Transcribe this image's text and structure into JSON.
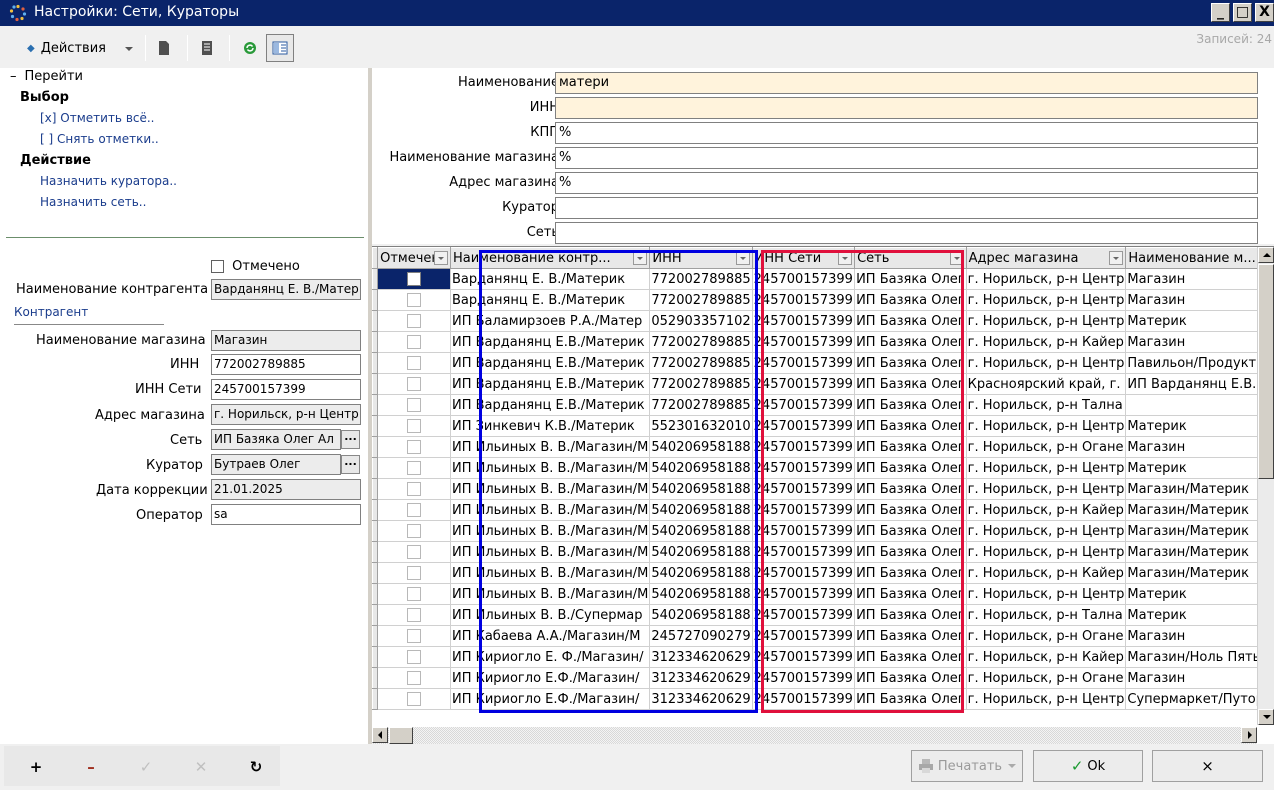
{
  "window": {
    "title": "Настройки: Сети, Кураторы",
    "min": "_",
    "max": "□",
    "close": "X"
  },
  "toolbar": {
    "actions_label": "Действия",
    "records_label": "Записей: 24"
  },
  "left_panel": {
    "goto": "Перейти",
    "select_header": "Выбор",
    "select_all": "[x]  Отметить всё..",
    "unselect": "[ ]  Снять отметки..",
    "action_header": "Действие",
    "assign_curator": "Назначить куратора..",
    "assign_network": "Назначить сеть.."
  },
  "detail": {
    "checked_label": "Отмечено",
    "counterparty_name_label": "Наименование контрагента",
    "counterparty_name": "Варданянц Е. В./Матер",
    "section_link": "Контрагент",
    "store_name_label": "Наименование магазина",
    "store_name": "Магазин",
    "inn_label": "ИНН",
    "inn": "772002789885",
    "network_inn_label": "ИНН Сети",
    "network_inn": "245700157399",
    "store_address_label": "Адрес магазина",
    "store_address": "г. Норильск, р-н Центр",
    "network_label": "Сеть",
    "network": "ИП Базяка Олег Ал",
    "curator_label": "Куратор",
    "curator": "Бутраев Олег",
    "date_label": "Дата коррекции",
    "date": "21.01.2025",
    "operator_label": "Оператор",
    "operator": "sa",
    "dots": "..."
  },
  "filters": [
    {
      "label": "Наименование",
      "value": "матери",
      "highlight": true
    },
    {
      "label": "ИНН",
      "value": "",
      "highlight": true
    },
    {
      "label": "КПП",
      "value": "%",
      "highlight": false
    },
    {
      "label": "Наименование магазина",
      "value": "%",
      "highlight": false
    },
    {
      "label": "Адрес магазина",
      "value": "%",
      "highlight": false
    },
    {
      "label": "Куратор",
      "value": "",
      "highlight": false
    },
    {
      "label": "Сеть",
      "value": "",
      "highlight": false
    }
  ],
  "grid": {
    "columns": [
      "Отмечено",
      "Наименование контр...",
      "ИНН",
      "ИНН Сети",
      "Сеть",
      "Адрес магазина",
      "Наименование м..."
    ],
    "rows": [
      [
        "Варданянц Е. В./Материк",
        "772002789885",
        "245700157399",
        "ИП Базяка Олег",
        "г. Норильск, р-н Центр",
        "Магазин"
      ],
      [
        "Варданянц Е. В./Материк",
        "772002789885",
        "245700157399",
        "ИП Базяка Олег",
        "г. Норильск, р-н Центр",
        "Магазин"
      ],
      [
        "ИП Баламирзоев Р.А./Матер",
        "052903357102",
        "245700157399",
        "ИП Базяка Олег",
        "г. Норильск, р-н Центр",
        "Материк"
      ],
      [
        "ИП Варданянц Е.В./Материк",
        "772002789885",
        "245700157399",
        "ИП Базяка Олег",
        "г. Норильск, р-н Кайер",
        "Магазин"
      ],
      [
        "ИП Варданянц Е.В./Материк",
        "772002789885",
        "245700157399",
        "ИП Базяка Олег",
        "г. Норильск, р-н Центр",
        "Павильон/Продукты"
      ],
      [
        "ИП Варданянц Е.В./Материк",
        "772002789885",
        "245700157399",
        "ИП Базяка Олег",
        "Красноярский край, г.",
        "ИП Варданянц Е.В."
      ],
      [
        "ИП Варданянц Е.В./Материк",
        "772002789885",
        "245700157399",
        "ИП Базяка Олег",
        "г. Норильск, р-н Тална",
        ""
      ],
      [
        "ИП Зинкевич К.В./Материк",
        "552301632010",
        "245700157399",
        "ИП Базяка Олег",
        "г. Норильск, р-н Центр",
        "Материк"
      ],
      [
        "ИП Ильиных В. В./Магазин/М",
        "540206958188",
        "245700157399",
        "ИП Базяка Олег",
        "г. Норильск, р-н Огане",
        "Магазин"
      ],
      [
        "ИП Ильиных В. В./Магазин/М",
        "540206958188",
        "245700157399",
        "ИП Базяка Олег",
        "г. Норильск, р-н Центр",
        "Материк"
      ],
      [
        "ИП Ильиных В. В./Магазин/М",
        "540206958188",
        "245700157399",
        "ИП Базяка Олег",
        "г. Норильск, р-н Центр",
        "Магазин/Материк"
      ],
      [
        "ИП Ильиных В. В./Магазин/М",
        "540206958188",
        "245700157399",
        "ИП Базяка Олег",
        "г. Норильск, р-н Кайер",
        "Магазин/Материк"
      ],
      [
        "ИП Ильиных В. В./Магазин/М",
        "540206958188",
        "245700157399",
        "ИП Базяка Олег",
        "г. Норильск, р-н Центр",
        "Магазин/Материк"
      ],
      [
        "ИП Ильиных В. В./Магазин/М",
        "540206958188",
        "245700157399",
        "ИП Базяка Олег",
        "г. Норильск, р-н Центр",
        "Магазин/Материк"
      ],
      [
        "ИП Ильиных В. В./Магазин/М",
        "540206958188",
        "245700157399",
        "ИП Базяка Олег",
        "г. Норильск, р-н Кайер",
        "Магазин/Материк"
      ],
      [
        "ИП Ильиных В. В./Магазин/М",
        "540206958188",
        "245700157399",
        "ИП Базяка Олег",
        "г. Норильск, р-н Центр",
        "Материк"
      ],
      [
        "ИП Ильиных В. В./Супермар",
        "540206958188",
        "245700157399",
        "ИП Базяка Олег",
        "г. Норильск, р-н Тална",
        "Материк"
      ],
      [
        "ИП Кабаева А.А./Магазин/М",
        "245727090279",
        "245700157399",
        "ИП Базяка Олег",
        "г. Норильск, р-н Огане",
        "Магазин"
      ],
      [
        "ИП Кириогло Е. Ф./Магазин/",
        "312334620629",
        "245700157399",
        "ИП Базяка Олег",
        "г. Норильск, р-н Кайер",
        "Магазин/Ноль Пять"
      ],
      [
        "ИП Кириогло Е.Ф./Магазин/",
        "312334620629",
        "245700157399",
        "ИП Базяка Олег",
        "г. Норильск, р-н Огане",
        "Магазин"
      ],
      [
        "ИП Кириогло Е.Ф./Магазин/",
        "312334620629",
        "245700157399",
        "ИП Базяка Олег",
        "г. Норильск, р-н Центр",
        "Супермаркет/Путора"
      ]
    ]
  },
  "bottom": {
    "print_label": "Печатать",
    "ok_label": "Ok",
    "cancel_label": "×"
  },
  "colors": {
    "titlebar": "#0a246a",
    "highlight_blue": "#0000e0",
    "highlight_red": "#e0103c",
    "filter_highlight": "#fff3dc"
  }
}
